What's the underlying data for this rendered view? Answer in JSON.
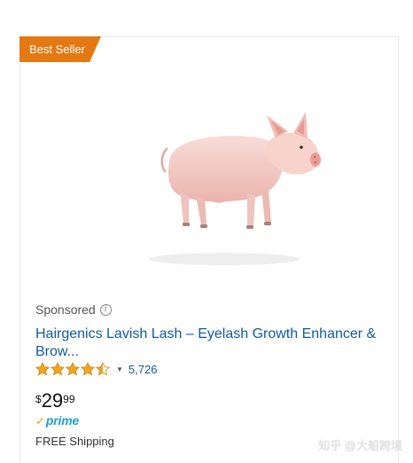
{
  "badge": {
    "label": "Best Seller",
    "color": "#e47911"
  },
  "product": {
    "image_icon": "pig-photo",
    "sponsored_label": "Sponsored",
    "info_icon": "info-icon",
    "title_line1": "Hairgenics Lavish Lash – Eyelash Growth Enhancer &",
    "title_line2": "Brow...",
    "rating": 4.5,
    "rating_max": 5,
    "review_count": "5,726",
    "price": {
      "symbol": "$",
      "whole": "29",
      "fraction": "99"
    },
    "prime_check": "✓",
    "prime_label": "prime",
    "shipping": "FREE Shipping"
  },
  "watermark": "知乎 @大船跨境",
  "colors": {
    "link": "#0f5a9e",
    "star": "#f4a41d",
    "prime_blue": "#1c9fd5",
    "prime_check": "#f39c1f"
  }
}
